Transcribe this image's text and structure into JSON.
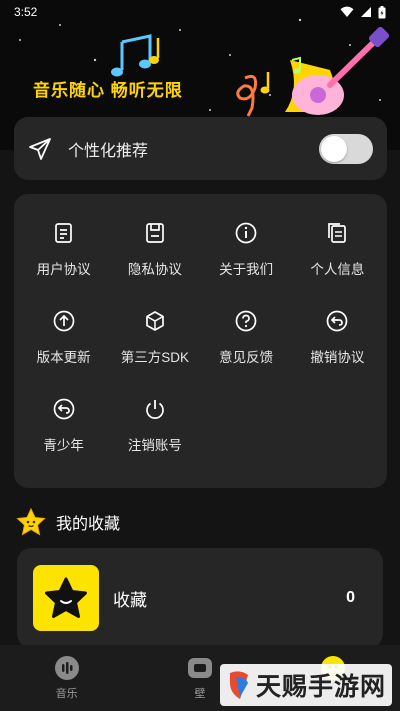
{
  "status_bar": {
    "time": "3:52"
  },
  "banner": {
    "slogan": "音乐随心 畅听无限"
  },
  "recommend": {
    "label": "个性化推荐",
    "enabled": false
  },
  "menu": {
    "items": [
      {
        "label": "用户协议",
        "icon": "document-icon"
      },
      {
        "label": "隐私协议",
        "icon": "save-icon"
      },
      {
        "label": "关于我们",
        "icon": "info-icon"
      },
      {
        "label": "个人信息",
        "icon": "copy-icon"
      },
      {
        "label": "版本更新",
        "icon": "arrow-up-circle-icon"
      },
      {
        "label": "第三方SDK",
        "icon": "cube-icon"
      },
      {
        "label": "意见反馈",
        "icon": "help-circle-icon"
      },
      {
        "label": "撤销协议",
        "icon": "undo-circle-icon"
      },
      {
        "label": "青少年",
        "icon": "back-circle-icon"
      },
      {
        "label": "注销账号",
        "icon": "power-icon"
      }
    ]
  },
  "favorites": {
    "title": "我的收藏",
    "item": {
      "name": "收藏",
      "count": "0"
    }
  },
  "tabs": [
    {
      "label": "音乐",
      "icon": "music-tab-icon"
    },
    {
      "label": "壁",
      "icon": "wallpaper-tab-icon"
    },
    {
      "label": "",
      "icon": "mine-tab-icon"
    }
  ],
  "watermark": {
    "text": "天赐手游网"
  },
  "colors": {
    "accent": "#fde300",
    "card": "#262626",
    "background": "#141414"
  }
}
